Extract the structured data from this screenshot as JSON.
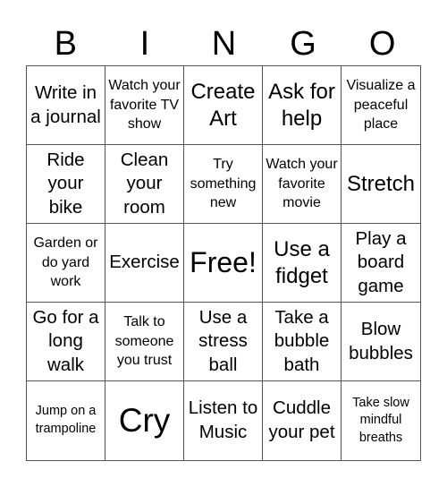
{
  "header": [
    "B",
    "I",
    "N",
    "G",
    "O"
  ],
  "cells": [
    "Write in a journal",
    "Watch your favorite TV show",
    "Create Art",
    "Ask for help",
    "Visualize a peaceful place",
    "Ride your bike",
    "Clean your room",
    "Try something new",
    "Watch your favorite movie",
    "Stretch",
    "Garden or do yard work",
    "Exercise",
    "Free!",
    "Use a fidget",
    "Play a board game",
    "Go for a long walk",
    "Talk to someone you trust",
    "Use a stress ball",
    "Take a bubble bath",
    "Blow bubbles",
    "Jump on a trampoline",
    "Cry",
    "Listen to Music",
    "Cuddle your pet",
    "Take slow mindful breaths"
  ]
}
